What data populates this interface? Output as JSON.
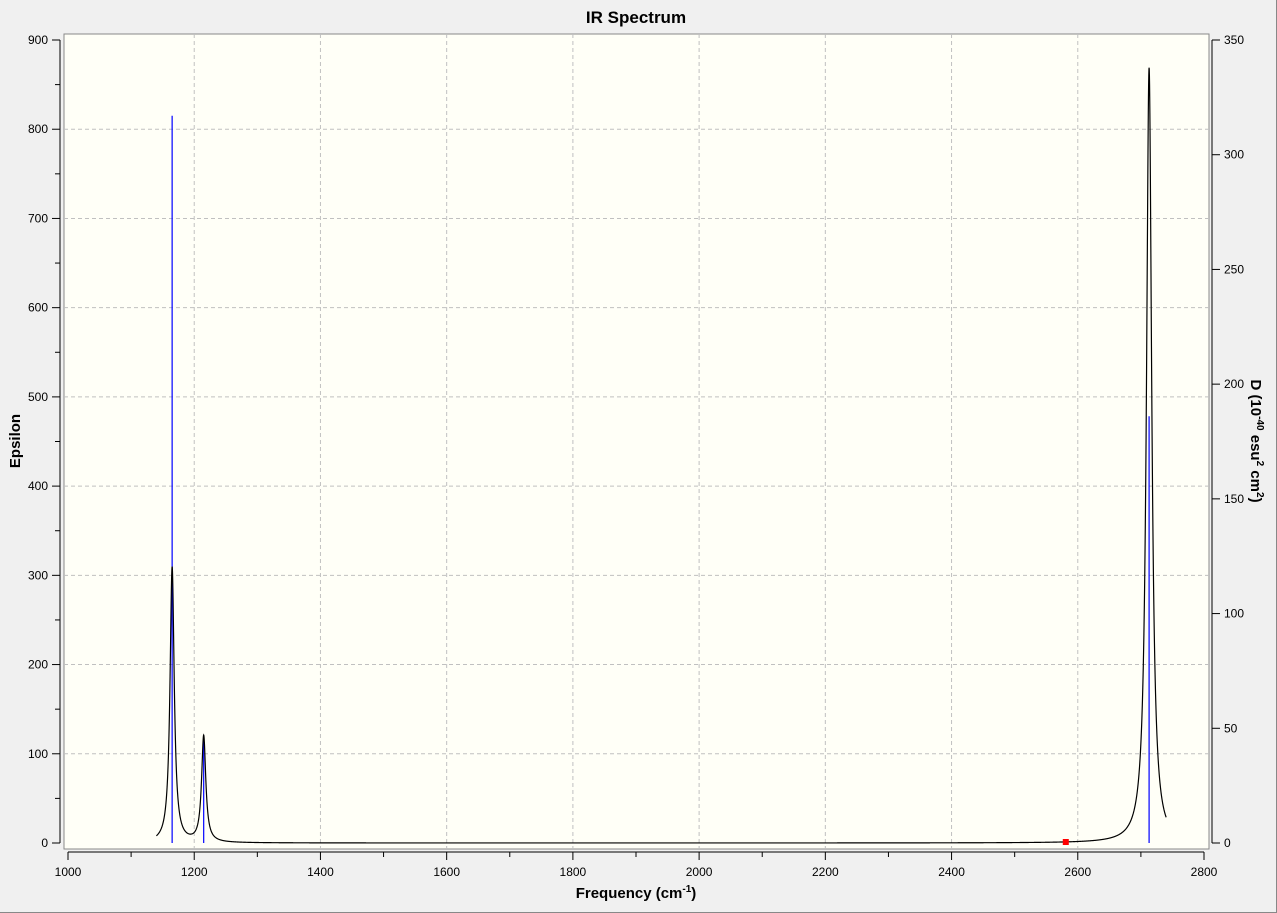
{
  "chart_data": {
    "type": "line",
    "title": "IR Spectrum",
    "xlabel": "Frequency (cm-1)",
    "xlabel_main": "Frequency (cm",
    "xlabel_sup": "-1",
    "xlabel_end": ")",
    "ylabel": "Epsilon",
    "y2label": "D (10-40 esu2 cm2)",
    "y2label_parts": [
      "D (10",
      "-40",
      " esu",
      "2",
      " cm",
      "2",
      ")"
    ],
    "xlim": [
      1000,
      2800
    ],
    "ylim": [
      0,
      900
    ],
    "y2lim": [
      0,
      350
    ],
    "xticks": [
      1000,
      1200,
      1400,
      1600,
      1800,
      2000,
      2200,
      2400,
      2600,
      2800
    ],
    "yticks": [
      0,
      100,
      200,
      300,
      400,
      500,
      600,
      700,
      800,
      900
    ],
    "y2ticks": [
      0,
      50,
      100,
      150,
      200,
      250,
      300,
      350
    ],
    "grid": true,
    "spectrum_range": [
      1140,
      2740
    ],
    "peaks": [
      {
        "freq": 1165,
        "epsilon": 309,
        "hwhm": 4,
        "D": 317
      },
      {
        "freq": 1215,
        "epsilon": 119,
        "hwhm": 4,
        "D": 46
      },
      {
        "freq": 2713,
        "epsilon": 869,
        "hwhm": 5,
        "D": 186
      }
    ],
    "marker": {
      "freq": 2581,
      "epsilon": 0
    },
    "colors": {
      "curve": "#000000",
      "sticks": "#0000ff",
      "marker": "#ff0000",
      "plot_bg": "#fffff7",
      "grid": "#c0c0c0"
    }
  }
}
